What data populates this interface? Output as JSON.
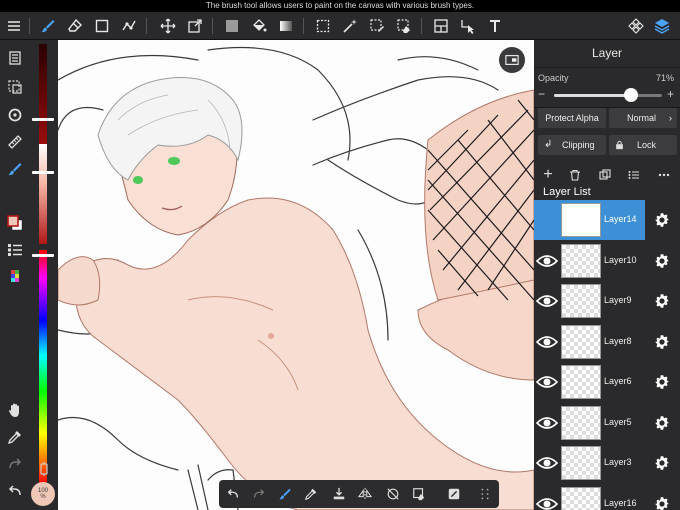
{
  "tooltip": "The brush tool allows users to paint on the canvas with various brush types.",
  "panel": {
    "title": "Layer",
    "opacity_label": "Opacity",
    "opacity_value": "71%",
    "opacity_fraction": 0.71,
    "minus": "−",
    "plus": "+",
    "protect_alpha": "Protect Alpha",
    "blend_mode": "Normal",
    "clipping": "Clipping",
    "lock": "Lock",
    "list_header": "Layer List"
  },
  "layers": [
    {
      "name": "Layer14",
      "selected": true
    },
    {
      "name": "Layer10",
      "selected": false
    },
    {
      "name": "Layer9",
      "selected": false
    },
    {
      "name": "Layer8",
      "selected": false
    },
    {
      "name": "Layer6",
      "selected": false
    },
    {
      "name": "Layer5",
      "selected": false
    },
    {
      "name": "Layer3",
      "selected": false
    },
    {
      "name": "Layer16",
      "selected": false
    }
  ],
  "zoom_badge": "100\n%",
  "colors": {
    "accent": "#4aa3ff",
    "selected_layer": "#3d8fd6",
    "primary_color": "#f0c8b8"
  }
}
